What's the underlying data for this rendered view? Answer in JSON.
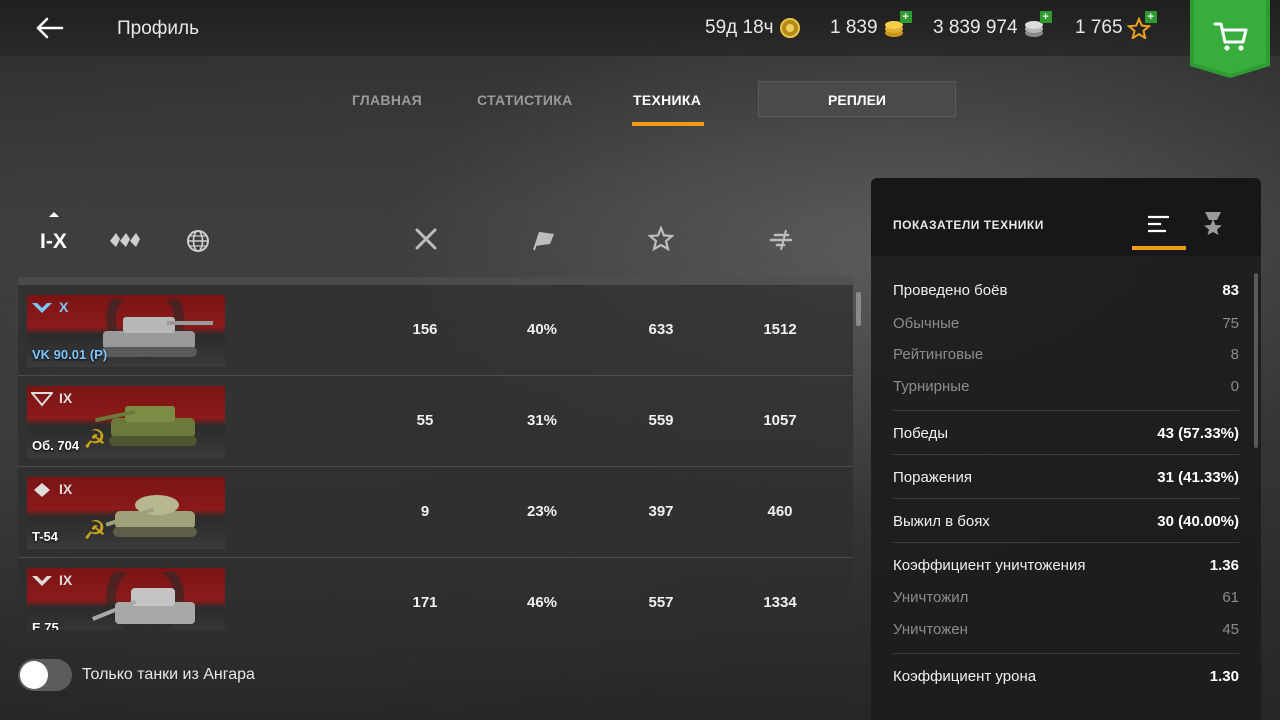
{
  "header": {
    "title": "Профиль",
    "premium_time": "59д 18ч",
    "gold": "1 839",
    "credits": "3 839 974",
    "free_xp": "1 765",
    "plus": "+"
  },
  "tabs": {
    "main": "ГЛАВНАЯ",
    "stats": "СТАТИСТИКА",
    "vehicles": "ТЕХНИКА",
    "replays": "РЕПЛЕИ"
  },
  "filters": {
    "tier_label": "I-X"
  },
  "vehicles": [
    {
      "tier": "X",
      "name": "VK 90.01 (P)",
      "nation": "germany",
      "battles": "156",
      "winrate": "40%",
      "mastery": "633",
      "damage": "1512"
    },
    {
      "tier": "IX",
      "name": "Об. 704",
      "nation": "ussr",
      "battles": "55",
      "winrate": "31%",
      "mastery": "559",
      "damage": "1057"
    },
    {
      "tier": "IX",
      "name": "T-54",
      "nation": "ussr",
      "battles": "9",
      "winrate": "23%",
      "mastery": "397",
      "damage": "460"
    },
    {
      "tier": "IX",
      "name": "E 75",
      "nation": "germany",
      "battles": "171",
      "winrate": "46%",
      "mastery": "557",
      "damage": "1334"
    }
  ],
  "hangar_toggle": {
    "label": "Только танки из Ангара",
    "checked": false
  },
  "panel": {
    "title": "ПОКАЗАТЕЛИ ТЕХНИКИ",
    "stats": {
      "battles_label": "Проведено боёв",
      "battles": "83",
      "regular_label": "Обычные",
      "regular": "75",
      "rated_label": "Рейтинговые",
      "rated": "8",
      "tournament_label": "Турнирные",
      "tournament": "0",
      "wins_label": "Победы",
      "wins": "43 (57.33%)",
      "losses_label": "Поражения",
      "losses": "31 (41.33%)",
      "survived_label": "Выжил в боях",
      "survived": "30 (40.00%)",
      "kd_label": "Коэффициент уничтожения",
      "kd": "1.36",
      "destroyed_label": "Уничтожил",
      "destroyed": "61",
      "deaths_label": "Уничтожен",
      "deaths": "45",
      "dmg_ratio_label": "Коэффициент урона",
      "dmg_ratio": "1.30"
    }
  },
  "colors": {
    "accent": "#f39a1a",
    "shop_green": "#2e9b33",
    "elite_blue": "#7cc6ff"
  }
}
